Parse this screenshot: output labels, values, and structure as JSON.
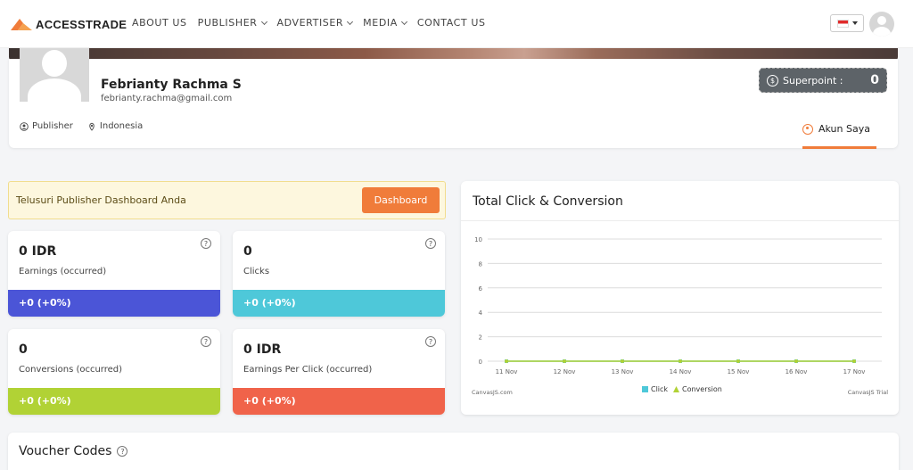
{
  "brand": {
    "name": "ACCESSTRADE",
    "accent": "#f07c3a"
  },
  "nav": {
    "items": [
      {
        "label": "ABOUT US",
        "dropdown": false
      },
      {
        "label": "PUBLISHER",
        "dropdown": true
      },
      {
        "label": "ADVERTISER",
        "dropdown": true
      },
      {
        "label": "MEDIA",
        "dropdown": true
      },
      {
        "label": "CONTACT US",
        "dropdown": false
      }
    ],
    "language_icon": "flag-indonesia-icon",
    "user_icon": "user-avatar-icon"
  },
  "profile": {
    "name": "Febrianty Rachma S",
    "email": "febrianty.rachma@gmail.com",
    "role": "Publisher",
    "country": "Indonesia",
    "superpoint_label": "Superpoint :",
    "superpoint_value": "0",
    "account_tab": "Akun Saya"
  },
  "callout": {
    "text": "Telusuri Publisher Dashboard Anda",
    "button": "Dashboard"
  },
  "stats": [
    {
      "value": "0 IDR",
      "label": "Earnings (occurred)",
      "change": "+0 (+0%)",
      "color": "#4b55d7"
    },
    {
      "value": "0",
      "label": "Clicks",
      "change": "+0 (+0%)",
      "color": "#4ec8d9"
    },
    {
      "value": "0",
      "label": "Conversions (occurred)",
      "change": "+0 (+0%)",
      "color": "#b1d235"
    },
    {
      "value": "0 IDR",
      "label": "Earnings Per Click (occurred)",
      "change": "+0 (+0%)",
      "color": "#f0634a"
    }
  ],
  "chart": {
    "title": "Total Click & Conversion",
    "credit_left": "CanvasJS.com",
    "credit_right": "CanvasJS Trial"
  },
  "chart_data": {
    "type": "line",
    "x": [
      "11 Nov",
      "12 Nov",
      "13 Nov",
      "14 Nov",
      "15 Nov",
      "16 Nov",
      "17 Nov"
    ],
    "series": [
      {
        "name": "Click",
        "values": [
          0,
          0,
          0,
          0,
          0,
          0,
          0
        ],
        "color": "#4ec8d9"
      },
      {
        "name": "Conversion",
        "values": [
          0,
          0,
          0,
          0,
          0,
          0,
          0
        ],
        "color": "#b1d235"
      }
    ],
    "yticks": [
      0,
      2,
      4,
      6,
      8,
      10
    ],
    "ylim": [
      0,
      10
    ],
    "grid": true,
    "legend": "bottom-center"
  },
  "voucher": {
    "title": "Voucher Codes"
  }
}
